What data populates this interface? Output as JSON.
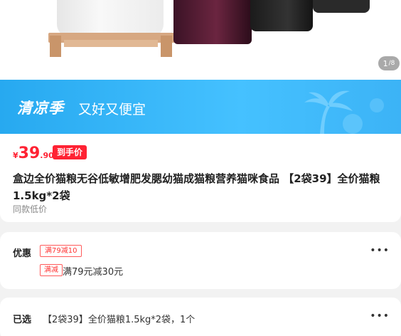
{
  "gallery": {
    "pager_current": "1",
    "pager_total": "8"
  },
  "banner": {
    "title": "清凉季",
    "subtitle": "又好又便宜"
  },
  "product": {
    "price_symbol": "¥",
    "price_integer": "39",
    "price_decimal": ".90",
    "price_tag": "到手价",
    "title": "盒边全价猫粮无谷低敏增肥发腮幼猫成猫粮营养猫咪食品 【2袋39】全价猫粮1.5kg*2袋",
    "subtitle": "同款低价"
  },
  "promo": {
    "label": "优惠",
    "coupon": "满79减10",
    "discount_tag": "满减",
    "discount_text": "满79元减30元",
    "more_icon": "more-dots-icon"
  },
  "selected": {
    "label": "已选",
    "value": "【2袋39】全价猫粮1.5kg*2袋，1个",
    "more_icon": "more-dots-icon"
  },
  "colors": {
    "price_red": "#ff2233",
    "banner_blue": "#3cb3f6"
  }
}
